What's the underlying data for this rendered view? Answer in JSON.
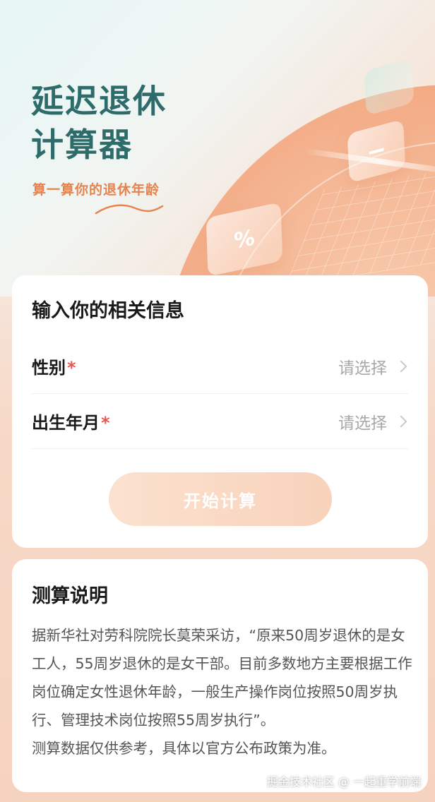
{
  "hero": {
    "title_line1": "延迟退休",
    "title_line2": "计算器",
    "subtitle": "算一算你的退休年龄",
    "percent_tile": "%",
    "minus_tile": "−"
  },
  "form": {
    "title": "输入你的相关信息",
    "gender": {
      "label": "性别",
      "required_mark": "*",
      "placeholder": "请选择"
    },
    "birth": {
      "label": "出生年月",
      "required_mark": "*",
      "placeholder": "请选择"
    },
    "start_button": "开始计算"
  },
  "info": {
    "title": "测算说明",
    "paragraph1": "据新华社对劳科院院长莫荣采访，“原来50周岁退休的是女工人，55周岁退休的是女干部。目前多数地方主要根据工作岗位确定女性退休年龄，一般生产操作岗位按照50周岁执行、管理技术岗位按照55周岁执行”。",
    "paragraph2": "测算数据仅供参考，具体以官方公布政策为准。"
  },
  "watermark": "掘金技术社区 @ 一起重学前端",
  "colors": {
    "title_green": "#2d6c6a",
    "accent_orange": "#e7834f",
    "required_red": "#e8574d",
    "button_bg": "#fbe2cf"
  }
}
